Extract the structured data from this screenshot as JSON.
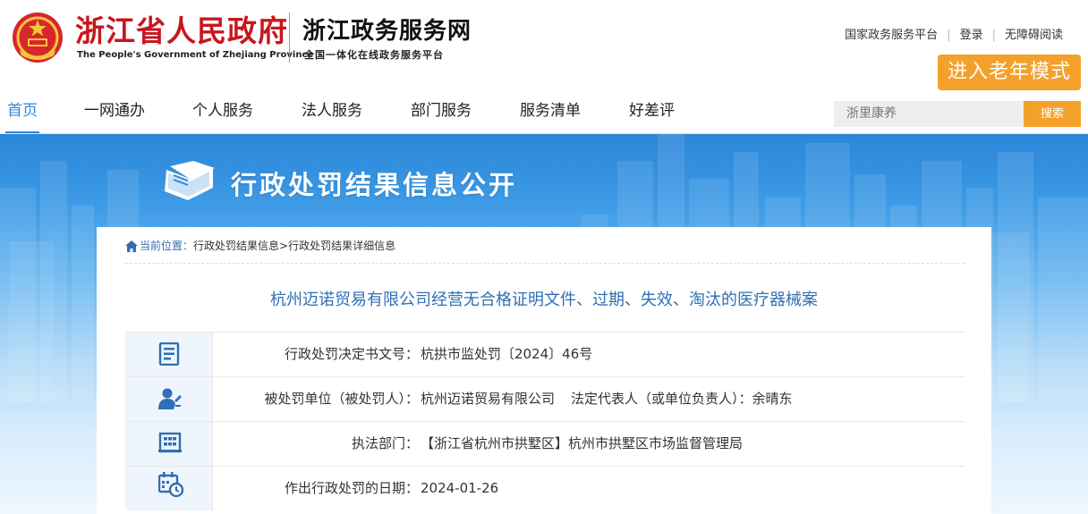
{
  "header": {
    "gov_title": "浙江省人民政府",
    "gov_title_en": "The People's Government of Zhejiang Province",
    "site_title": "浙江政务服务网",
    "site_subtitle": "全国一体化在线政务服务平台",
    "top_links": [
      "国家政务服务平台",
      "登录",
      "无障碍阅读"
    ],
    "elder_mode_label": "进入老年模式"
  },
  "nav": {
    "items": [
      "首页",
      "一网通办",
      "个人服务",
      "法人服务",
      "部门服务",
      "服务清单",
      "好差评"
    ],
    "active_index": 0
  },
  "search": {
    "placeholder": "浙里康养",
    "button_label": "搜索"
  },
  "banner": {
    "title": "行政处罚结果信息公开"
  },
  "breadcrumb": {
    "current_label": "当前位置：",
    "items": [
      "行政处罚结果信息>",
      "行政处罚结果详细信息"
    ]
  },
  "case": {
    "title": "杭州迈诺贸易有限公司经营无合格证明文件、过期、失效、淘汰的医疗器械案",
    "rows": [
      {
        "icon": "document-icon",
        "label": "行政处罚决定书文号：",
        "value": "杭拱市监处罚〔2024〕46号"
      },
      {
        "icon": "person-icon",
        "label": "被处罚单位（被处罚人）：",
        "value": "杭州迈诺贸易有限公司",
        "extra": "法定代表人（或单位负责人）：余晴东"
      },
      {
        "icon": "building-icon",
        "label": "执法部门：",
        "value": "【浙江省杭州市拱墅区】杭州市拱墅区市场监督管理局"
      },
      {
        "icon": "calendar-clock-icon",
        "label": "作出行政处罚的日期：",
        "value": "2024-01-26"
      }
    ]
  },
  "colors": {
    "brand_red": "#c8161d",
    "nav_active": "#2f86d6",
    "accent_orange": "#f4a12b",
    "title_blue": "#2f6fb5"
  }
}
